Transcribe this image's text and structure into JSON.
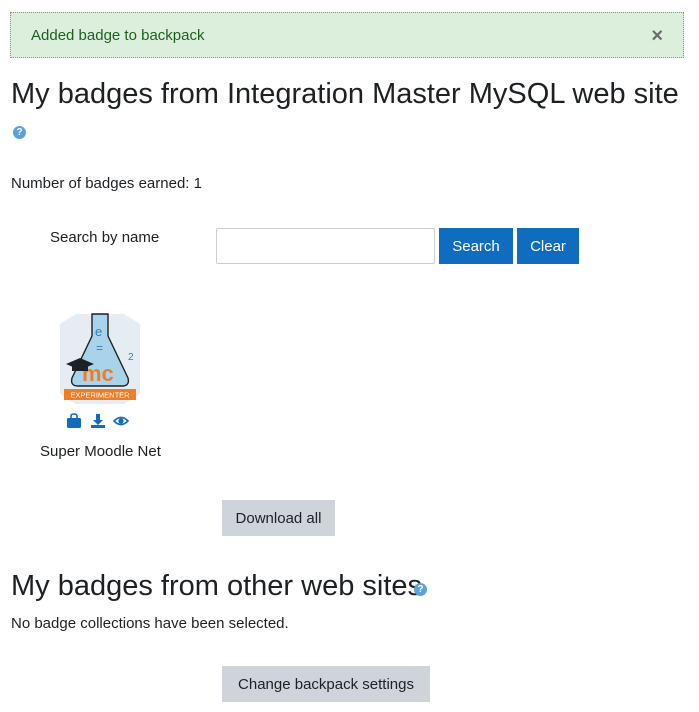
{
  "alert": {
    "message": "Added badge to backpack",
    "close_glyph": "×"
  },
  "section_site": {
    "title": "My badges from Integration Master MySQL web site",
    "help_glyph": "?",
    "count_text": "Number of badges earned: 1"
  },
  "search": {
    "label": "Search by name",
    "value": "",
    "button_label": "Search",
    "clear_label": "Clear"
  },
  "badge": {
    "name": "Super Moodle Net",
    "image_text": "EXPERIMENTER",
    "image_letters": "mc",
    "icons": [
      "backpack-icon",
      "download-icon",
      "view-icon"
    ]
  },
  "download_all_label": "Download all",
  "section_other": {
    "title": "My badges from other web sites",
    "help_glyph": "?",
    "empty_text": "No badge collections have been selected."
  },
  "backpack_settings_label": "Change backpack settings",
  "colors": {
    "primary": "#0f6cbf",
    "secondary": "#ced4da",
    "success_bg": "#dcefdc",
    "success_text": "#1e5f20",
    "badge_orange": "#f47c20"
  }
}
